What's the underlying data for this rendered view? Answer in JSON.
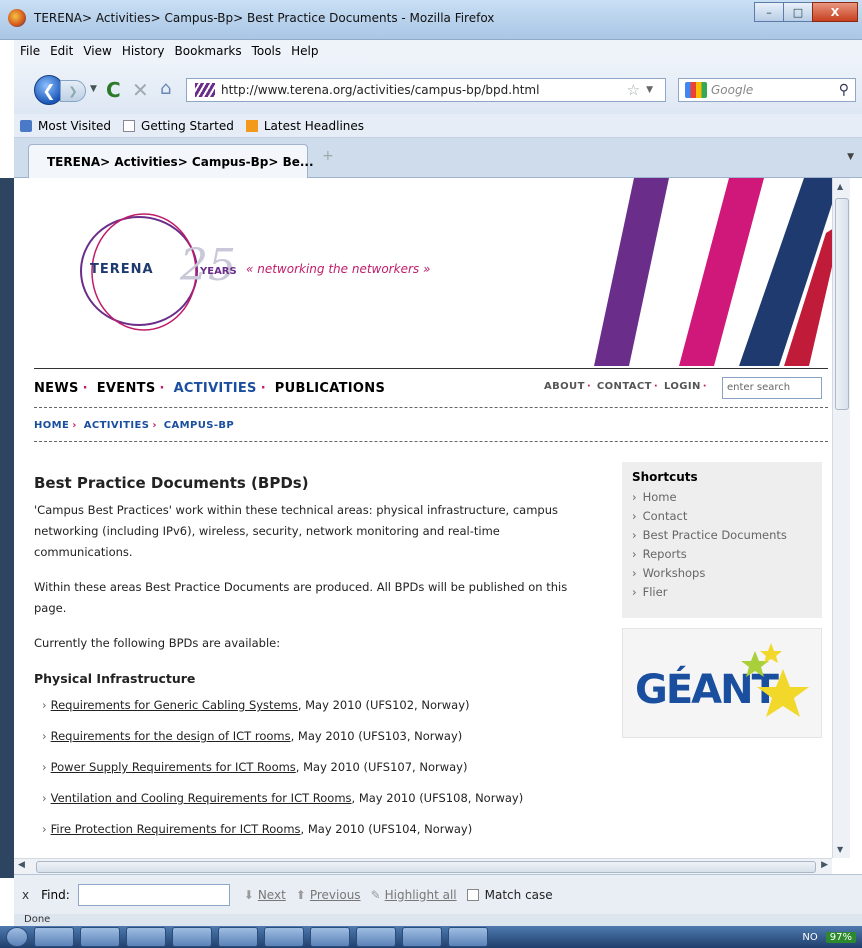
{
  "window": {
    "title": "TERENA> Activities> Campus-Bp> Best Practice Documents - Mozilla Firefox",
    "minimize": "–",
    "maximize": "□",
    "close": "X"
  },
  "menu": [
    "File",
    "Edit",
    "View",
    "History",
    "Bookmarks",
    "Tools",
    "Help"
  ],
  "nav": {
    "url": "http://www.terena.org/activities/campus-bp/bpd.html",
    "search_placeholder": "Google"
  },
  "bookmarks": [
    "Most Visited",
    "Getting Started",
    "Latest Headlines"
  ],
  "tab": {
    "label": "TERENA> Activities> Campus-Bp> Be...",
    "new_tab": "+"
  },
  "site": {
    "logo_name": "TERENA",
    "logo_number": "25",
    "logo_years": "YEARS",
    "tagline": "« networking the networkers »",
    "main_nav": [
      "NEWS",
      "EVENTS",
      "ACTIVITIES",
      "PUBLICATIONS"
    ],
    "utility_nav": [
      "ABOUT",
      "CONTACT",
      "LOGIN"
    ],
    "search_placeholder": "enter search",
    "breadcrumb": [
      "HOME",
      "ACTIVITIES",
      "CAMPUS-BP"
    ]
  },
  "article": {
    "heading": "Best Practice Documents (BPDs)",
    "para1": "'Campus Best Practices' work within these technical areas: physical infrastructure, campus networking (including IPv6), wireless, security, network monitoring and real-time communications.",
    "para2": "Within these areas Best Practice Documents are produced. All BPDs will be published on this page.",
    "para3": "Currently the following BPDs are available:",
    "section": "Physical Infrastructure",
    "items": [
      {
        "link": "Requirements for Generic Cabling Systems",
        "meta": ", May 2010 (UFS102, Norway)"
      },
      {
        "link": "Requirements for the design of ICT rooms",
        "meta": ", May 2010 (UFS103, Norway)"
      },
      {
        "link": "Power Supply Requirements for ICT Rooms",
        "meta": ", May 2010 (UFS107, Norway)"
      },
      {
        "link": "Ventilation and Cooling Requirements for ICT Rooms",
        "meta": ", May 2010 (UFS108, Norway)"
      },
      {
        "link": "Fire Protection Requirements for ICT Rooms",
        "meta": ", May 2010 (UFS104, Norway)"
      }
    ]
  },
  "shortcuts": {
    "title": "Shortcuts",
    "items": [
      "Home",
      "Contact",
      "Best Practice Documents",
      "Reports",
      "Workshops",
      "Flier"
    ]
  },
  "geant": {
    "word": "GÉANT"
  },
  "findbar": {
    "close": "x",
    "label": "Find:",
    "next": "Next",
    "previous": "Previous",
    "highlight": "Highlight all",
    "match_case": "Match case"
  },
  "status": {
    "text": "Done"
  },
  "taskbar": {
    "tray_lang": "NO",
    "battery": "97%"
  },
  "colors": {
    "accent_pink": "#c01c6a",
    "accent_blue": "#1a4e9e",
    "purple": "#6b2d8a"
  }
}
